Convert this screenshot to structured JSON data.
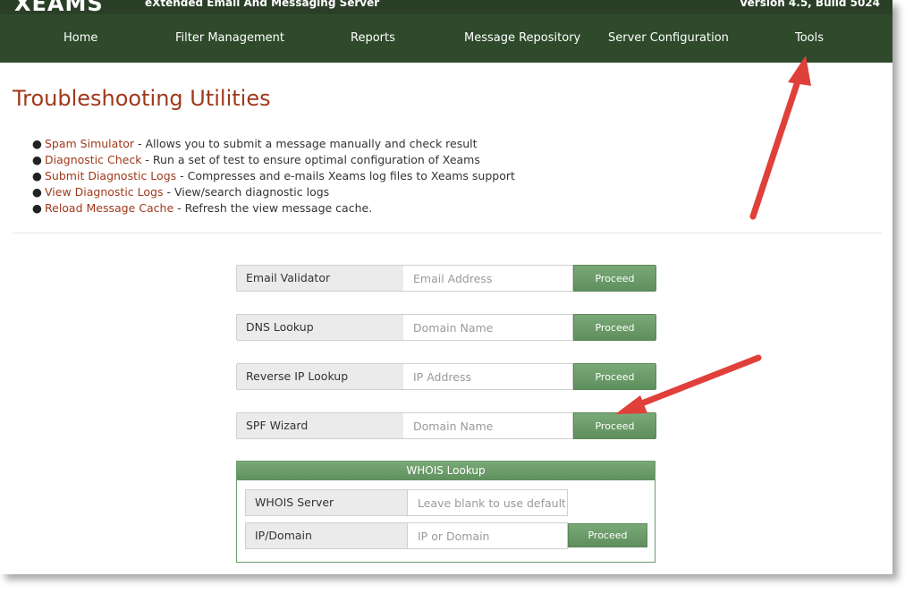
{
  "header": {
    "logo": "XEAMS",
    "tagline": "eXtended Email And Messaging Server",
    "version": "Version 4.5, Build 5024"
  },
  "nav": {
    "items": [
      {
        "label": "Home"
      },
      {
        "label": "Filter Management"
      },
      {
        "label": "Reports"
      },
      {
        "label": "Message Repository"
      },
      {
        "label": "Server Configuration"
      },
      {
        "label": "Tools"
      }
    ]
  },
  "page_title": "Troubleshooting Utilities",
  "utilities": [
    {
      "link": "Spam Simulator",
      "desc": " - Allows you to submit a message manually and check result"
    },
    {
      "link": "Diagnostic Check",
      "desc": " - Run a set of test to ensure optimal configuration of Xeams"
    },
    {
      "link": "Submit Diagnostic Logs",
      "desc": " - Compresses and e-mails Xeams log files to Xeams support"
    },
    {
      "link": "View Diagnostic Logs",
      "desc": " - View/search diagnostic logs"
    },
    {
      "link": "Reload Message Cache",
      "desc": " - Refresh the view message cache."
    }
  ],
  "tools": [
    {
      "label": "Email Validator",
      "placeholder": "Email Address",
      "button": "Proceed"
    },
    {
      "label": "DNS Lookup",
      "placeholder": "Domain Name",
      "button": "Proceed"
    },
    {
      "label": "Reverse IP Lookup",
      "placeholder": "IP Address",
      "button": "Proceed"
    },
    {
      "label": "SPF Wizard",
      "placeholder": "Domain Name",
      "button": "Proceed"
    }
  ],
  "whois": {
    "title": "WHOIS Lookup",
    "server_label": "WHOIS Server",
    "server_placeholder": "Leave blank to use default",
    "domain_label": "IP/Domain",
    "domain_placeholder": "IP or Domain",
    "button": "Proceed"
  },
  "colors": {
    "nav_bg": "#2e4a2b",
    "accent_link": "#a0391b",
    "button_green": "#6b9b69",
    "annotation_arrow": "#e0403a"
  }
}
